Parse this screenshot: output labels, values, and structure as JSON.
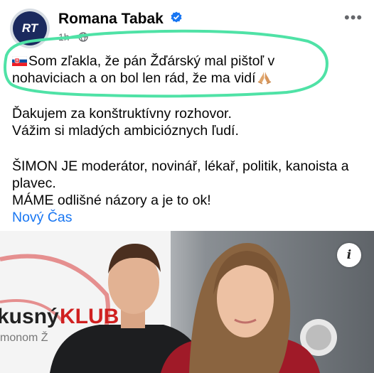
{
  "author": {
    "name": "Romana Tabak",
    "avatar_text": "RT",
    "time": "1h",
    "separator": "·"
  },
  "post": {
    "line1": "Som zľakla, že pán Žďárský mal pištoľ v",
    "line2": "nohaviciach a on bol len rád, že ma vidí",
    "para2": [
      "Ďakujem za konštruktívny rozhovor.",
      "Vážim si mladých ambicióznych ľudí."
    ],
    "para3": [
      "ŠIMON JE moderátor, novinář, lékař, politik, kanoista a",
      "plavec.",
      "MÁME odlišné názory a je to ok!"
    ],
    "link": "Nový Čas"
  },
  "photo": {
    "sign_text_1": "kusný",
    "sign_text_2": "KLUB",
    "sign_text_3": "monom Ž"
  },
  "colors": {
    "highlight": "#4fe2a6",
    "link": "#1876f2",
    "verified": "#1876f2"
  },
  "icons": [
    "verified-badge-icon",
    "globe-icon",
    "more-icon",
    "slovak-flag-icon",
    "folded-hands-icon",
    "info-icon"
  ]
}
